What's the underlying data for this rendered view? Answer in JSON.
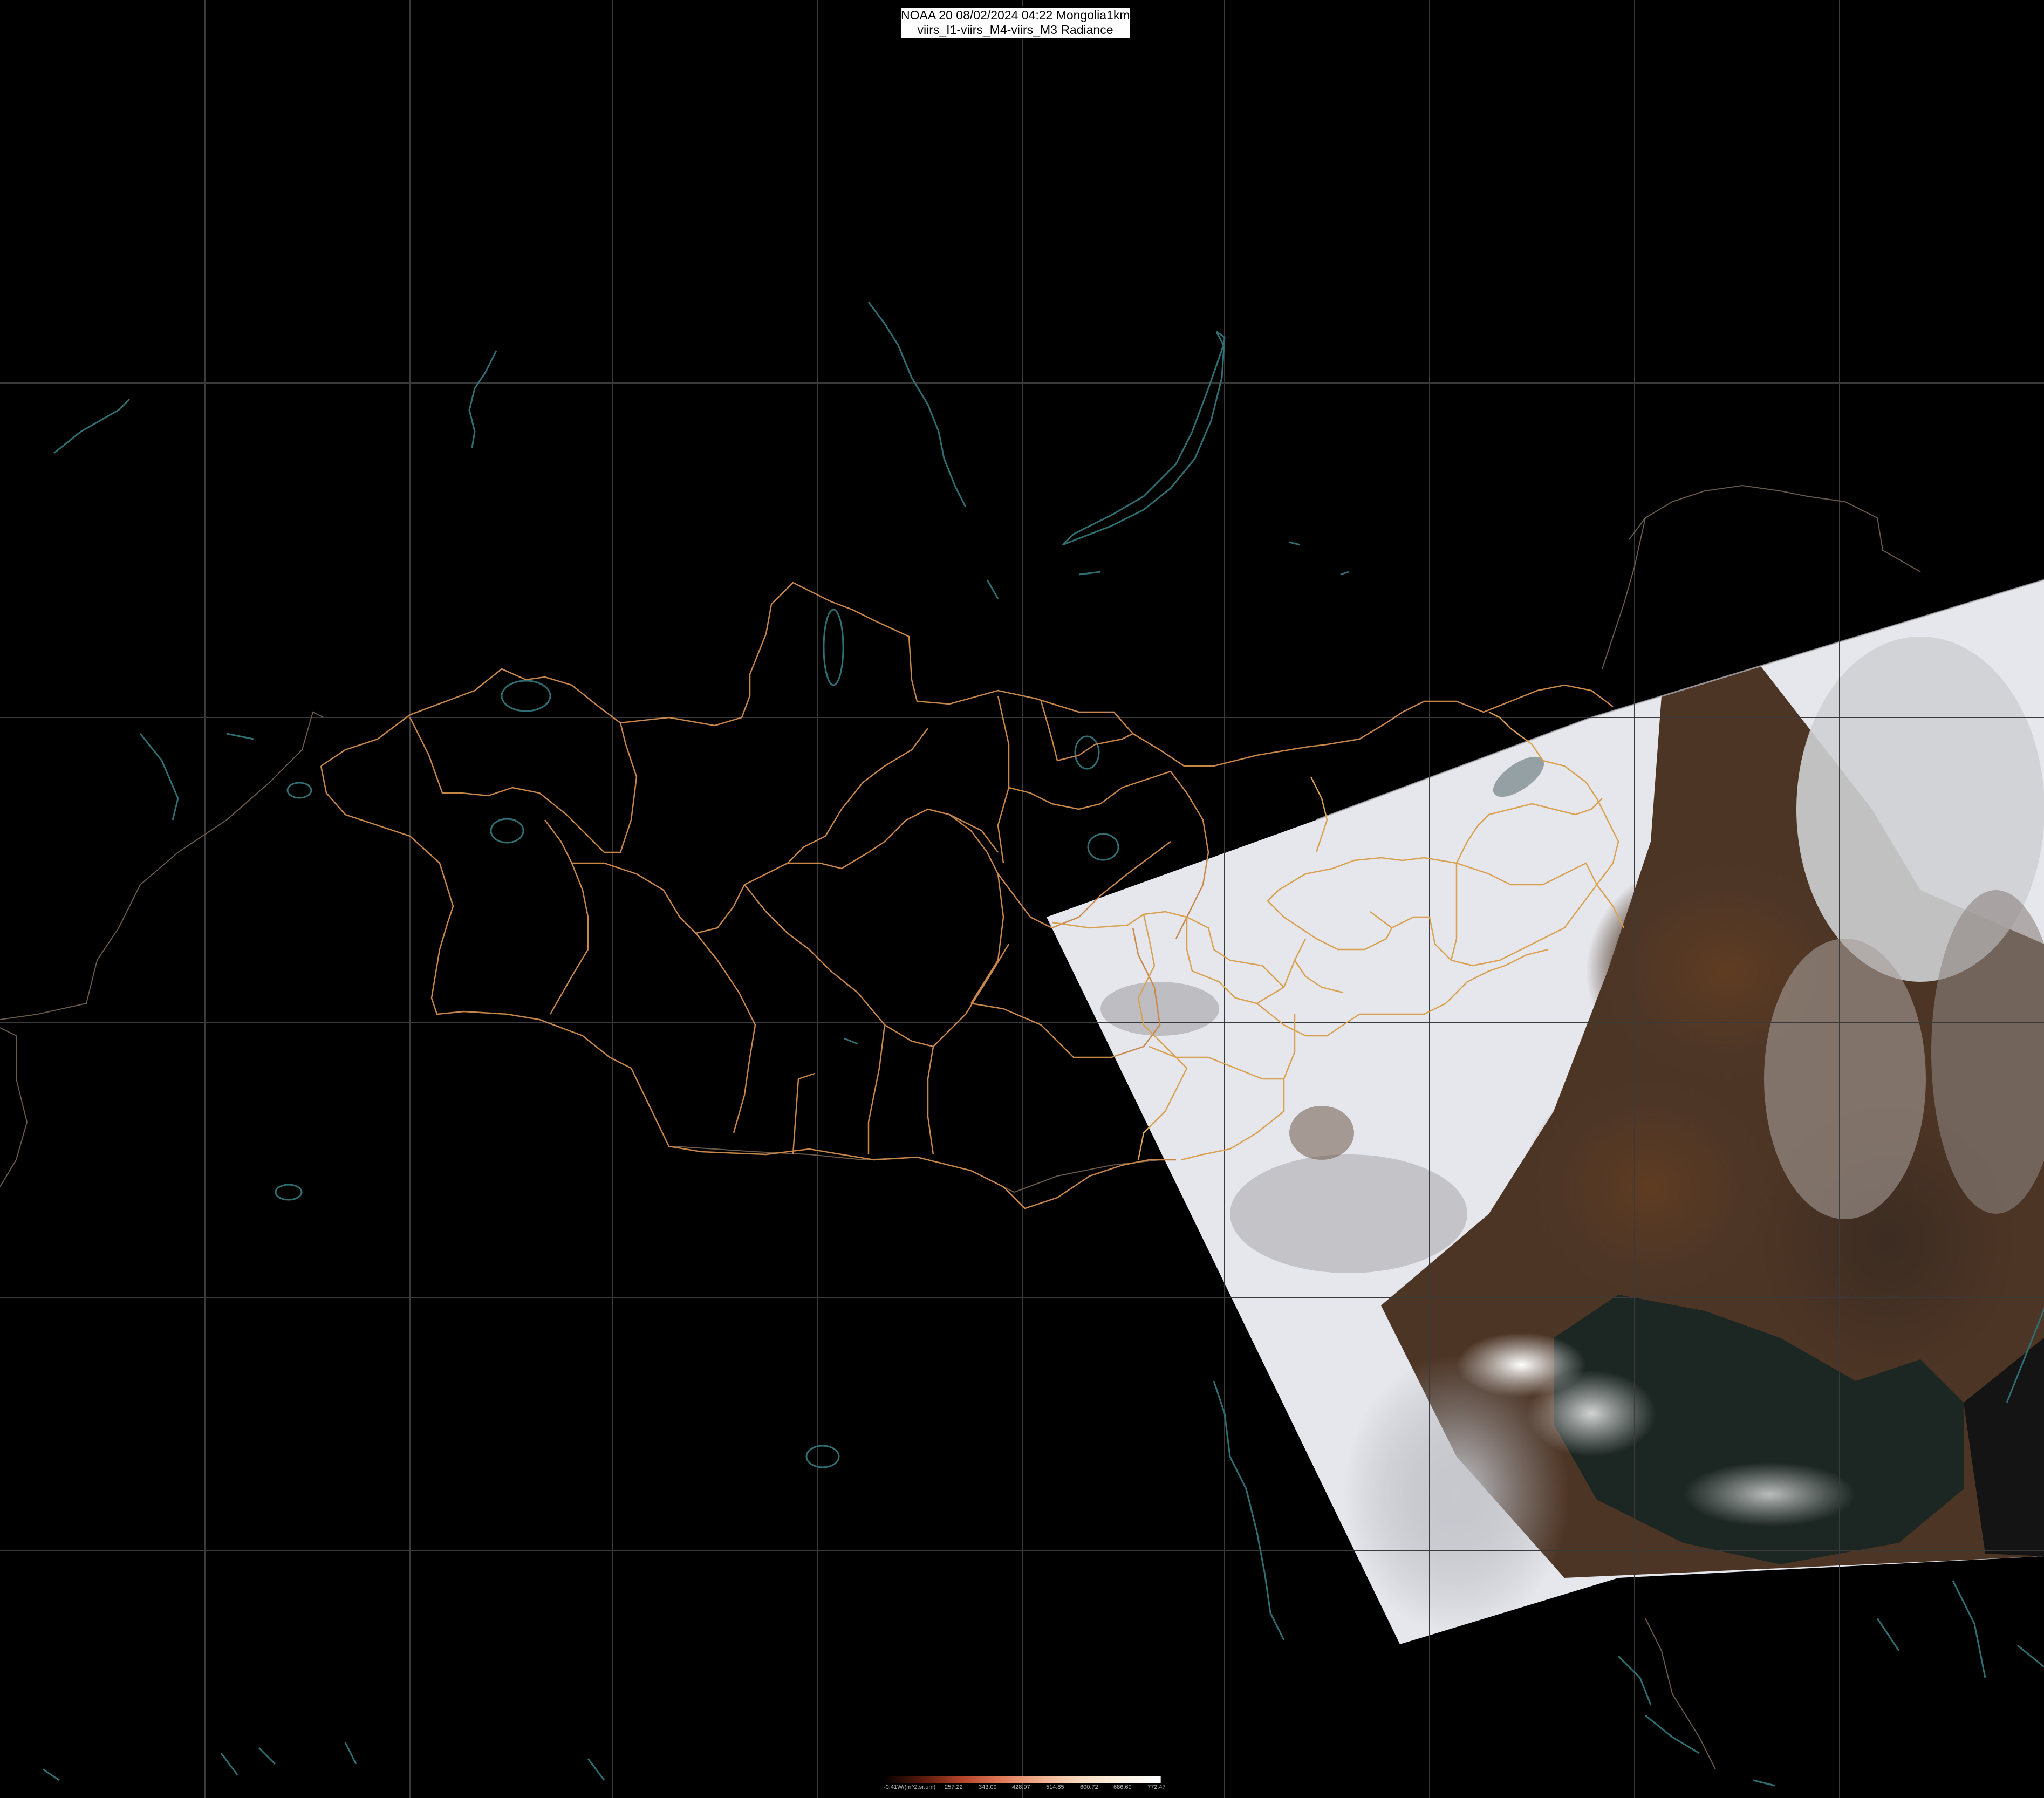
{
  "title": {
    "line1": "NOAA 20 08/02/2024 04:22 Mongolia1km",
    "line2": "viirs_I1-viirs_M4-viirs_M3 Radiance"
  },
  "colors": {
    "background": "#000000",
    "graticule": "#3a3a3a",
    "admin_boundary": "#c88648",
    "admin_boundary_on_swath": "#d9a050",
    "water_outline": "#2f6f74",
    "snow": "#e8e9ee",
    "land_bare": "#5a3e2a",
    "sea": "#1e2a26"
  },
  "colorbar": {
    "ticks": [
      "-0.41W/(m^2.sr.um)",
      "257.22",
      "343.09",
      "428.97",
      "514.85",
      "600.72",
      "686.60",
      "772.47"
    ],
    "gradient": [
      "#000000",
      "#5a1a0c",
      "#b3442a",
      "#e07a5a",
      "#f0b090",
      "#f7dcc0",
      "#fbf1e2",
      "#ffffff"
    ]
  }
}
